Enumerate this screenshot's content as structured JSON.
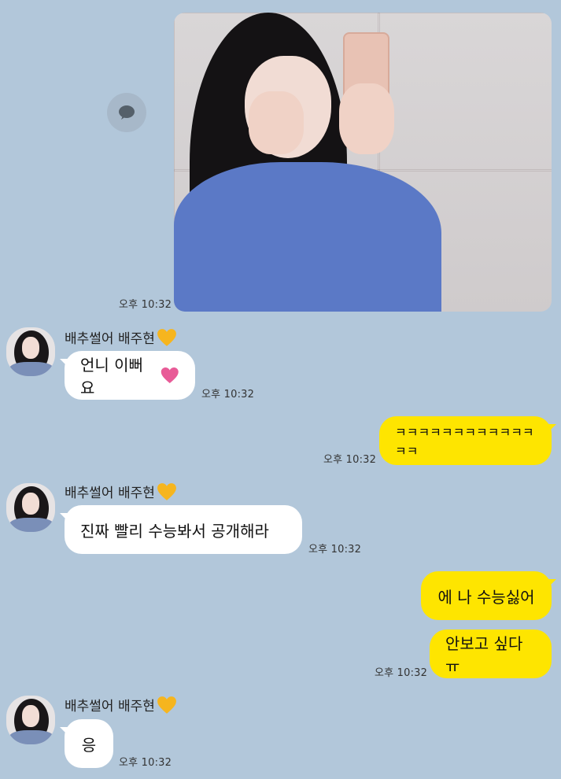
{
  "chat": {
    "photo_message": {
      "time": "오후 10:32"
    },
    "messages": [
      {
        "sender": "배추썰어 배주현",
        "text": "언니 이뻐요",
        "time": "오후 10:32"
      },
      {
        "text": "ㅋㅋㅋㅋㅋㅋㅋㅋㅋㅋㅋㅋㅋㅋ",
        "time": "오후 10:32"
      },
      {
        "sender": "배추썰어 배주현",
        "text": "진짜 빨리 수능봐서 공개해라",
        "time": "오후 10:32"
      },
      {
        "text": "에 나 수능싫어"
      },
      {
        "text": "안보고 싶다ㅠ",
        "time": "오후 10:32"
      },
      {
        "sender": "배추썰어 배주현",
        "text": "응",
        "time": "오후 10:32"
      }
    ]
  },
  "icons": {
    "share": "speech-bubble-icon",
    "sender_heart": "yellow-heart-icon",
    "message_heart": "pink-heart-icon"
  },
  "colors": {
    "background": "#b2c7da",
    "my_bubble": "#fee500",
    "their_bubble": "#ffffff",
    "heart_yellow": "#f6b51e",
    "heart_pink": "#e85b97"
  }
}
